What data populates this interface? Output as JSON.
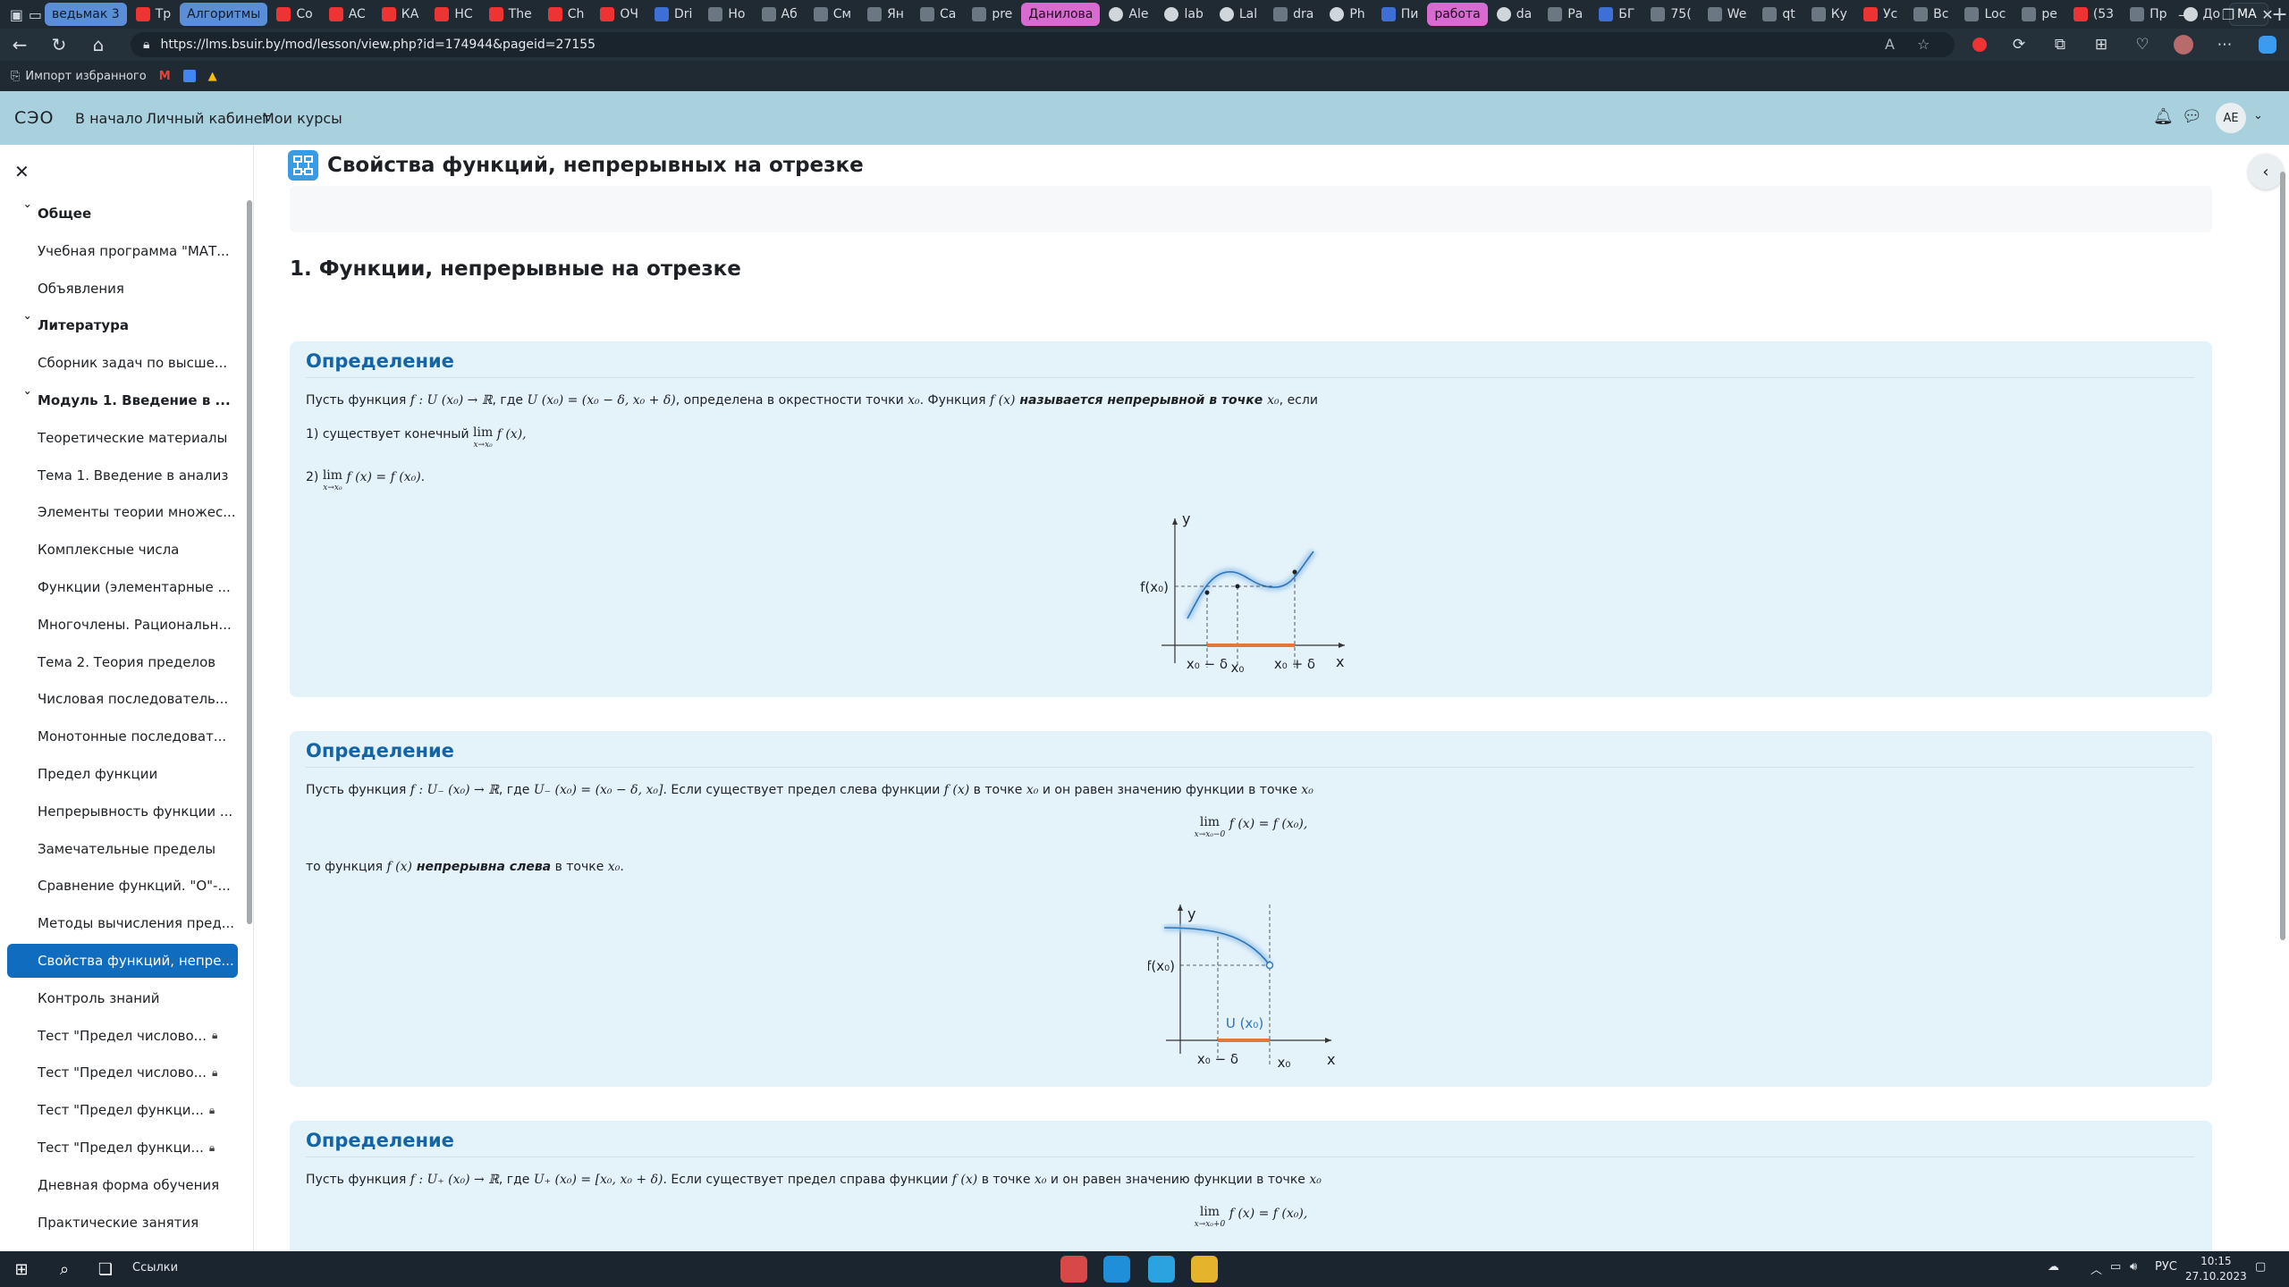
{
  "browser": {
    "tabs": [
      {
        "label": "ведьмак 3",
        "style": "pill-blue",
        "icon": "none"
      },
      {
        "label": "Тр",
        "style": "",
        "icon": "red"
      },
      {
        "label": "Алгоритмы",
        "style": "pill-blue",
        "icon": "none"
      },
      {
        "label": "Co",
        "style": "",
        "icon": "red"
      },
      {
        "label": "AC",
        "style": "",
        "icon": "red"
      },
      {
        "label": "КА",
        "style": "",
        "icon": "red"
      },
      {
        "label": "НС",
        "style": "",
        "icon": "red"
      },
      {
        "label": "The",
        "style": "",
        "icon": "red"
      },
      {
        "label": "Ch",
        "style": "",
        "icon": "red"
      },
      {
        "label": "ОЧ",
        "style": "",
        "icon": "red"
      },
      {
        "label": "Dri",
        "style": "",
        "icon": "blue"
      },
      {
        "label": "Ho",
        "style": "",
        "icon": "gray"
      },
      {
        "label": "Аб",
        "style": "",
        "icon": "gray"
      },
      {
        "label": "См",
        "style": "",
        "icon": "gray"
      },
      {
        "label": "Ян",
        "style": "",
        "icon": "gray"
      },
      {
        "label": "Са",
        "style": "",
        "icon": "gray"
      },
      {
        "label": "pre",
        "style": "",
        "icon": "gray"
      },
      {
        "label": "Данилова",
        "style": "pill-pink",
        "icon": "none"
      },
      {
        "label": "Ale",
        "style": "",
        "icon": "gh"
      },
      {
        "label": "lab",
        "style": "",
        "icon": "gh"
      },
      {
        "label": "Lal",
        "style": "",
        "icon": "gh"
      },
      {
        "label": "dra",
        "style": "",
        "icon": "gray"
      },
      {
        "label": "Ph",
        "style": "",
        "icon": "gh"
      },
      {
        "label": "Пи",
        "style": "",
        "icon": "blue"
      },
      {
        "label": "работа",
        "style": "pill-pink",
        "icon": "none"
      },
      {
        "label": "da",
        "style": "",
        "icon": "gh"
      },
      {
        "label": "Ра",
        "style": "",
        "icon": "gray"
      },
      {
        "label": "БГ",
        "style": "",
        "icon": "blue"
      },
      {
        "label": "75(",
        "style": "",
        "icon": "gray"
      },
      {
        "label": "We",
        "style": "",
        "icon": "gray"
      },
      {
        "label": "qt",
        "style": "",
        "icon": "gray"
      },
      {
        "label": "Ку",
        "style": "",
        "icon": "gray"
      },
      {
        "label": "Ус",
        "style": "",
        "icon": "red"
      },
      {
        "label": "Вс",
        "style": "",
        "icon": "gray"
      },
      {
        "label": "Loc",
        "style": "",
        "icon": "gray"
      },
      {
        "label": "ре",
        "style": "",
        "icon": "gray"
      },
      {
        "label": "(53",
        "style": "",
        "icon": "red"
      },
      {
        "label": "Пр",
        "style": "",
        "icon": "gray"
      },
      {
        "label": "До",
        "style": "",
        "icon": "gh"
      },
      {
        "label": "MA",
        "style": "active",
        "icon": "none"
      }
    ],
    "url": "https://lms.bsuir.by/mod/lesson/view.php?id=174944&pageid=27155",
    "bookmarks": [
      {
        "label": "Импорт избранного",
        "icon": "import-icon"
      },
      {
        "label": "",
        "icon": "gmail-icon"
      },
      {
        "label": "",
        "icon": "calendar-icon"
      },
      {
        "label": "",
        "icon": "drive-icon"
      }
    ]
  },
  "moodle": {
    "logo": "СЭО",
    "nav": [
      "В начало",
      "Личный кабинет",
      "Мои курсы"
    ],
    "avatar_initials": "AE"
  },
  "drawer": {
    "items": [
      {
        "label": "Общее",
        "type": "section"
      },
      {
        "label": "Учебная программа \"МАТ...",
        "type": "activity"
      },
      {
        "label": "Объявления",
        "type": "activity"
      },
      {
        "label": "Литература",
        "type": "section"
      },
      {
        "label": "Сборник задач по высше...",
        "type": "activity"
      },
      {
        "label": "Модуль 1. Введение в ...",
        "type": "section"
      },
      {
        "label": "Теоретические материалы",
        "type": "activity"
      },
      {
        "label": "Тема 1. Введение в анализ",
        "type": "activity"
      },
      {
        "label": "Элементы теории множес...",
        "type": "activity"
      },
      {
        "label": "Комплексные числа",
        "type": "activity"
      },
      {
        "label": "Функции (элементарные ...",
        "type": "activity"
      },
      {
        "label": "Многочлены. Рациональн...",
        "type": "activity"
      },
      {
        "label": "Тема 2. Теория пределов",
        "type": "activity"
      },
      {
        "label": "Числовая последователь...",
        "type": "activity"
      },
      {
        "label": "Монотонные последоват...",
        "type": "activity"
      },
      {
        "label": "Предел функции",
        "type": "activity"
      },
      {
        "label": "Непрерывность функции ...",
        "type": "activity"
      },
      {
        "label": "Замечательные пределы",
        "type": "activity"
      },
      {
        "label": "Сравнение функций. \"О\"-...",
        "type": "activity"
      },
      {
        "label": "Методы вычисления пред...",
        "type": "activity"
      },
      {
        "label": "Свойства функций, непре...",
        "type": "activity",
        "active": true
      },
      {
        "label": "Контроль знаний",
        "type": "activity"
      },
      {
        "label": "Тест \"Предел числово...",
        "type": "activity",
        "locked": true
      },
      {
        "label": "Тест \"Предел числово...",
        "type": "activity",
        "locked": true
      },
      {
        "label": "Тест \"Предел функци...",
        "type": "activity",
        "locked": true
      },
      {
        "label": "Тест \"Предел функци...",
        "type": "activity",
        "locked": true
      },
      {
        "label": "Дневная форма обучения",
        "type": "activity"
      },
      {
        "label": "Практические занятия",
        "type": "activity"
      },
      {
        "label": "ПЗ. Комплексные числа",
        "type": "activity"
      }
    ]
  },
  "page": {
    "title": "Свойства функций, непрерывных на отрезке",
    "section_heading": "1. Функции, непрерывные на отрезке",
    "def1": {
      "title": "Определение",
      "line1": {
        "p1": "Пусть функция ",
        "m1": "f : U (x₀) → ℝ",
        "p2": ", где ",
        "m2": "U (x₀) = (x₀ − δ, x₀ + δ)",
        "p3": ", определена в окрестности точки ",
        "m3": "x₀",
        "p4": ". Функция ",
        "m4": "f (x)",
        "b1": " называется непрерывной в точке ",
        "m5": "x₀",
        "p5": ", если"
      },
      "line2": {
        "p1": "1) существует конечный ",
        "m1": "lim",
        "sub": "x→x₀",
        "m2": " f (x),"
      },
      "line3": {
        "p1": "2) ",
        "m1": "lim",
        "sub": "x→x₀",
        "m2": " f (x) = f (x₀)."
      },
      "graph_labels": {
        "y": "y",
        "x": "x",
        "fx0": "f(x₀)",
        "x0m": "x₀ − δ",
        "x0": "x₀",
        "x0p": "x₀ + δ"
      }
    },
    "def2": {
      "title": "Определение",
      "line1": {
        "p1": "Пусть функция ",
        "m1": "f : U₋ (x₀) → ℝ",
        "p2": ", где ",
        "m2": "U₋ (x₀) = (x₀ − δ, x₀]",
        "p3": ". Если существует предел слева функции ",
        "m3": "f (x)",
        "p4": " в точке ",
        "m4": "x₀",
        "p5": " и он равен значению функции в точке ",
        "m5": "x₀"
      },
      "formula": {
        "lim": "lim",
        "sub": "x→x₀−0",
        "rest": "f (x) = f (x₀),"
      },
      "line2": {
        "p1": "то функция ",
        "m1": "f (x)",
        "b1": " непрерывна слева",
        "p2": " в точке ",
        "m2": "x₀",
        "p3": "."
      },
      "graph_labels": {
        "y": "y",
        "x": "x",
        "fx0": "f(x₀)",
        "u": "U (x₀)",
        "x0m": "x₀ − δ",
        "x0": "x₀"
      }
    },
    "def3": {
      "title": "Определение",
      "line1": {
        "p1": "Пусть функция ",
        "m1": "f : U₊ (x₀) → ℝ",
        "p2": ", где ",
        "m2": "U₊ (x₀) = [x₀, x₀ + δ)",
        "p3": ". Если существует предел справа функции ",
        "m3": "f (x)",
        "p4": " в точке ",
        "m4": "x₀",
        "p5": " и он равен значению функции в точке ",
        "m5": "x₀"
      },
      "formula": {
        "lim": "lim",
        "sub": "x→x₀+0",
        "rest": "f (x) = f (x₀),"
      }
    }
  },
  "taskbar": {
    "search_label": "Ссылки",
    "lang": "РУС",
    "time": "10:15",
    "date": "27.10.2023"
  }
}
